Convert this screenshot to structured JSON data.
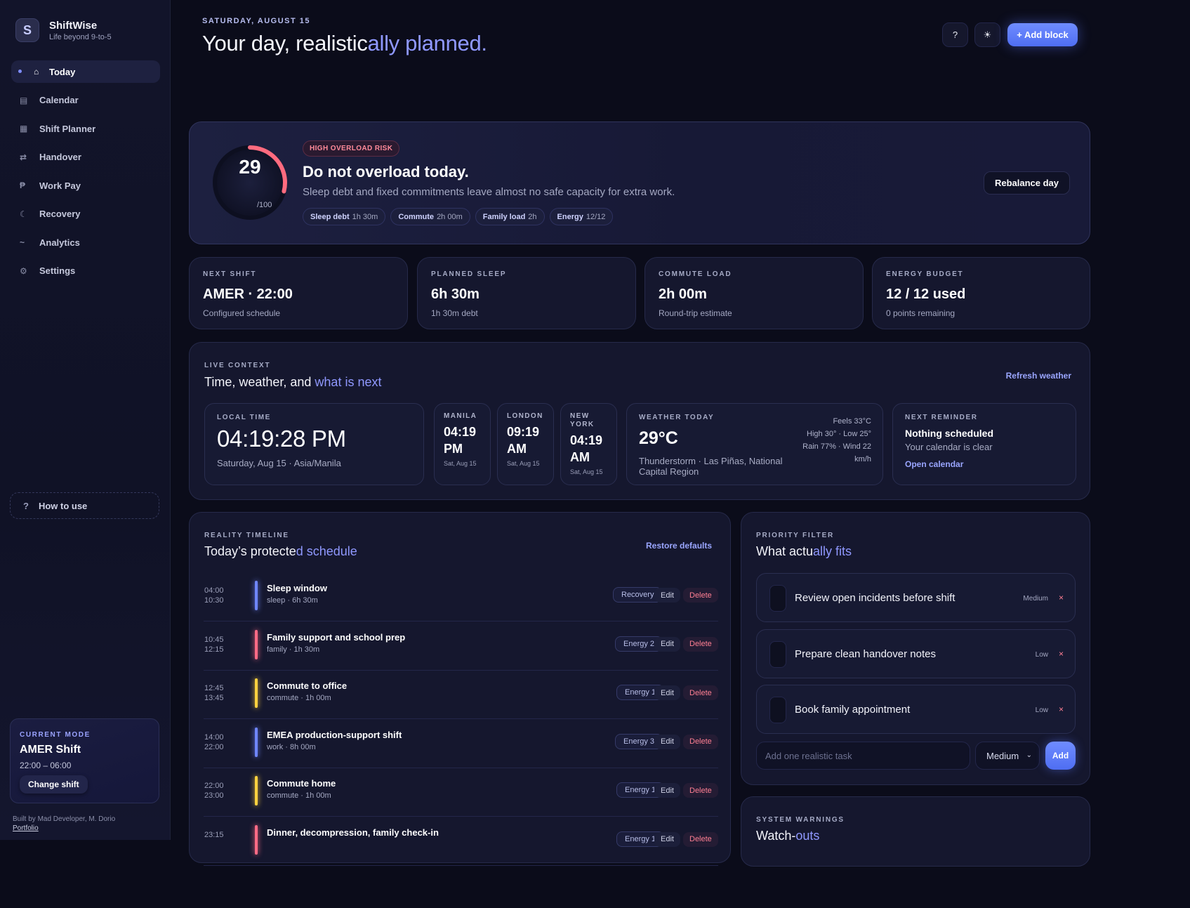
{
  "brand": {
    "name": "ShiftWise",
    "tagline": "Life beyond 9-to-5",
    "logo_letter": "S"
  },
  "nav": [
    {
      "label": "Today",
      "icon": "home-icon",
      "glyph": "⌂",
      "active": true
    },
    {
      "label": "Calendar",
      "icon": "calendar-icon",
      "glyph": "▤"
    },
    {
      "label": "Shift Planner",
      "icon": "planner-icon",
      "glyph": "▦"
    },
    {
      "label": "Handover",
      "icon": "swap-icon",
      "glyph": "⇄"
    },
    {
      "label": "Work Pay",
      "icon": "peso-icon",
      "glyph": "₱"
    },
    {
      "label": "Recovery",
      "icon": "moon-icon",
      "glyph": "☾"
    },
    {
      "label": "Analytics",
      "icon": "trend-icon",
      "glyph": "~"
    },
    {
      "label": "Settings",
      "icon": "gear-icon",
      "glyph": "⚙"
    }
  ],
  "how_to_use": {
    "label": "How to use",
    "glyph": "?"
  },
  "current_mode": {
    "kicker": "CURRENT MODE",
    "title": "AMER Shift",
    "time": "22:00 – 06:00",
    "button": "Change shift"
  },
  "credits": {
    "text": "Built by Mad Developer, M. Dorio",
    "link": "Portfolio"
  },
  "header": {
    "date": "SATURDAY, AUGUST 15",
    "title_main": "Your day, realistic",
    "title_accent": "ally planned.",
    "help_glyph": "?",
    "theme_glyph": "☀",
    "add_block": "+ Add block"
  },
  "risk": {
    "score": "29",
    "score_max": "/100",
    "score_value": 29,
    "badge": "HIGH OVERLOAD RISK",
    "title": "Do not overload today.",
    "description": "Sleep debt and fixed commitments leave almost no safe capacity for extra work.",
    "chips": [
      {
        "label": "Sleep debt",
        "value": "1h 30m"
      },
      {
        "label": "Commute",
        "value": "2h 00m"
      },
      {
        "label": "Family load",
        "value": "2h"
      },
      {
        "label": "Energy",
        "value": "12/12"
      }
    ],
    "rebalance": "Rebalance day",
    "colors": {
      "ring": "#ff6b7f",
      "track": "#1a1c36"
    }
  },
  "stats": [
    {
      "kicker": "NEXT SHIFT",
      "value": "AMER · 22:00",
      "sub": "Configured schedule"
    },
    {
      "kicker": "PLANNED SLEEP",
      "value": "6h 30m",
      "sub": "1h 30m debt"
    },
    {
      "kicker": "COMMUTE LOAD",
      "value": "2h 00m",
      "sub": "Round-trip estimate"
    },
    {
      "kicker": "ENERGY BUDGET",
      "value": "12 / 12 used",
      "sub": "0 points remaining"
    }
  ],
  "live": {
    "kicker": "LIVE CONTEXT",
    "title_main": "Time, weather, and ",
    "title_accent": "what is next",
    "refresh": "Refresh weather",
    "local": {
      "kicker": "LOCAL TIME",
      "time": "04:19:28 PM",
      "sub": "Saturday, Aug 15 · Asia/Manila"
    },
    "cities": [
      {
        "name": "MANILA",
        "time": "04:19 PM",
        "date": "Sat, Aug 15"
      },
      {
        "name": "LONDON",
        "time": "09:19 AM",
        "date": "Sat, Aug 15"
      },
      {
        "name": "NEW YORK",
        "time": "04:19 AM",
        "date": "Sat, Aug 15"
      }
    ],
    "weather": {
      "kicker": "WEATHER TODAY",
      "temp": "29°C",
      "location": "Thunderstorm · Las Piñas, National Capital Region",
      "feels": "Feels 33°C",
      "hilo": "High 30° · Low 25°",
      "rain": "Rain 77% · Wind 22 km/h"
    },
    "reminder": {
      "kicker": "NEXT REMINDER",
      "title": "Nothing scheduled",
      "sub": "Your calendar is clear",
      "link": "Open calendar"
    }
  },
  "timeline": {
    "kicker": "REALITY TIMELINE",
    "title_main": "Today’s protecte",
    "title_accent": "d schedule",
    "restore": "Restore defaults",
    "edit_label": "Edit",
    "delete_label": "Delete",
    "items": [
      {
        "start": "04:00",
        "end": "10:30",
        "title": "Sleep window",
        "sub": "sleep · 6h 30m",
        "tag": "Recovery",
        "color": "#6f86ff"
      },
      {
        "start": "10:45",
        "end": "12:15",
        "title": "Family support and school prep",
        "sub": "family · 1h 30m",
        "tag": "Energy 2",
        "color": "#ff6b86"
      },
      {
        "start": "12:45",
        "end": "13:45",
        "title": "Commute to office",
        "sub": "commute · 1h 00m",
        "tag": "Energy 1",
        "color": "#ffd23f"
      },
      {
        "start": "14:00",
        "end": "22:00",
        "title": "EMEA production-support shift",
        "sub": "work · 8h 00m",
        "tag": "Energy 3",
        "color": "#6f86ff"
      },
      {
        "start": "22:00",
        "end": "23:00",
        "title": "Commute home",
        "sub": "commute · 1h 00m",
        "tag": "Energy 1",
        "color": "#ffd23f"
      },
      {
        "start": "23:15",
        "end": "",
        "title": "Dinner, decompression, family check-in",
        "sub": "",
        "tag": "Energy 1",
        "color": "#ff6b86"
      }
    ]
  },
  "priority": {
    "kicker": "PRIORITY FILTER",
    "title_main": "What actu",
    "title_accent": "ally fits",
    "tasks": [
      {
        "title": "Review open incidents before shift",
        "priority": "Medium"
      },
      {
        "title": "Prepare clean handover notes",
        "priority": "Low"
      },
      {
        "title": "Book family appointment",
        "priority": "Low"
      }
    ],
    "remove_glyph": "×",
    "input_placeholder": "Add one realistic task",
    "select_value": "Medium",
    "add": "Add"
  },
  "warnings": {
    "kicker": "SYSTEM WARNINGS",
    "title_main": "Watch-",
    "title_accent": "outs"
  }
}
